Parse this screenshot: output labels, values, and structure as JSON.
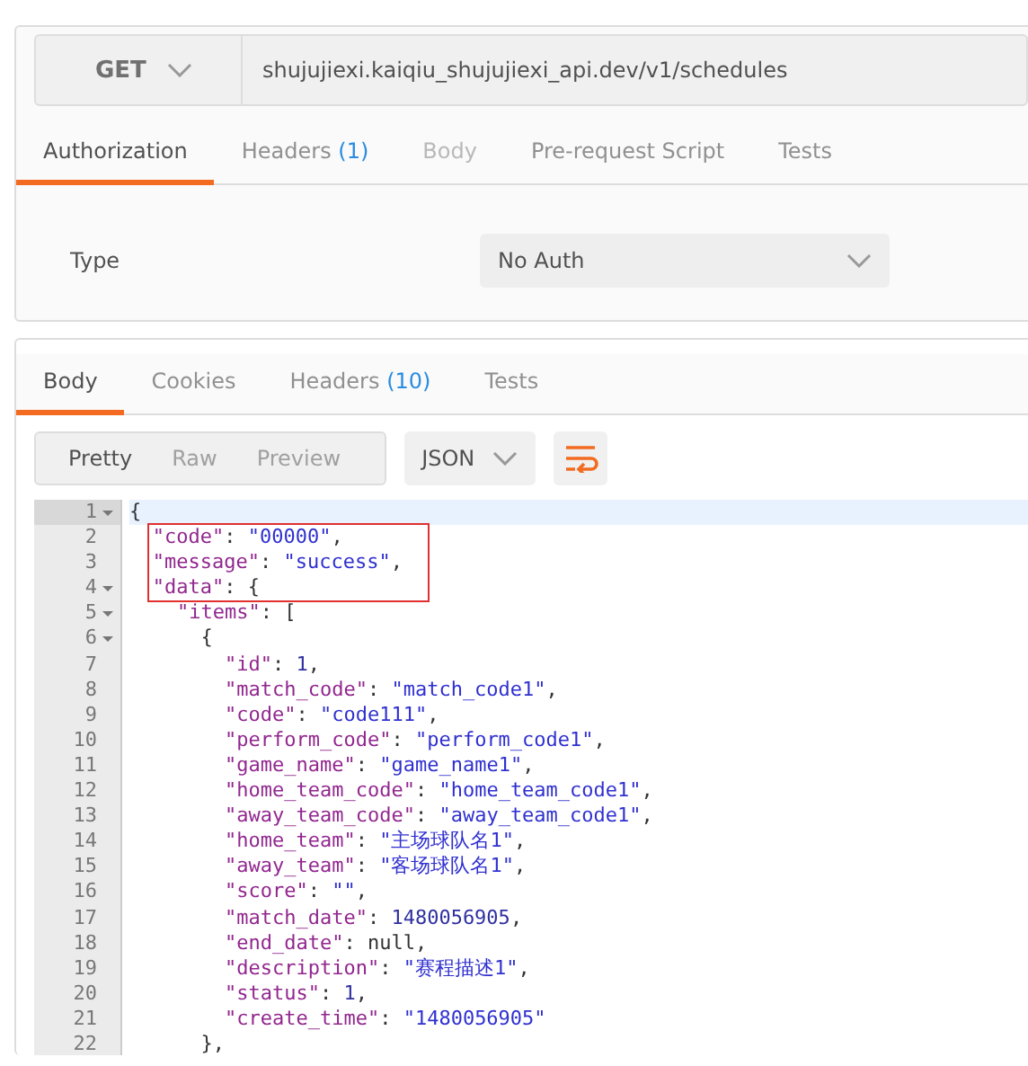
{
  "request": {
    "method": "GET",
    "url": "shujujiexi.kaiqiu_shujujiexi_api.dev/v1/schedules"
  },
  "request_tabs": [
    {
      "label": "Authorization",
      "selected": true,
      "disabled": false
    },
    {
      "label": "Headers",
      "count": "(1)",
      "selected": false,
      "disabled": false
    },
    {
      "label": "Body",
      "selected": false,
      "disabled": true
    },
    {
      "label": "Pre-request Script",
      "selected": false,
      "disabled": false
    },
    {
      "label": "Tests",
      "selected": false,
      "disabled": false
    }
  ],
  "auth": {
    "label": "Type",
    "value": "No Auth"
  },
  "response_tabs": [
    {
      "label": "Body",
      "selected": true
    },
    {
      "label": "Cookies",
      "selected": false
    },
    {
      "label": "Headers",
      "count": "(10)",
      "selected": false
    },
    {
      "label": "Tests",
      "selected": false
    }
  ],
  "view_modes": [
    {
      "label": "Pretty",
      "selected": true
    },
    {
      "label": "Raw",
      "selected": false
    },
    {
      "label": "Preview",
      "selected": false
    }
  ],
  "format": {
    "value": "JSON"
  },
  "wrap_lines": {
    "on": true
  },
  "code_lines": [
    {
      "number": "1",
      "fold": true,
      "active": true,
      "boxed": false,
      "tokens": [
        {
          "kind": "punct",
          "text": "{"
        }
      ]
    },
    {
      "number": "2",
      "fold": false,
      "active": false,
      "boxed": true,
      "tokens": [
        {
          "kind": "key",
          "text": "  \"code\""
        },
        {
          "kind": "punct",
          "text": ": "
        },
        {
          "kind": "string",
          "text": "\"00000\""
        },
        {
          "kind": "punct",
          "text": ","
        }
      ]
    },
    {
      "number": "3",
      "fold": false,
      "active": false,
      "boxed": true,
      "tokens": [
        {
          "kind": "key",
          "text": "  \"message\""
        },
        {
          "kind": "punct",
          "text": ": "
        },
        {
          "kind": "string",
          "text": "\"success\""
        },
        {
          "kind": "punct",
          "text": ","
        }
      ]
    },
    {
      "number": "4",
      "fold": true,
      "active": false,
      "boxed": true,
      "tokens": [
        {
          "kind": "key",
          "text": "  \"data\""
        },
        {
          "kind": "punct",
          "text": ": {"
        }
      ]
    },
    {
      "number": "5",
      "fold": true,
      "active": false,
      "boxed": false,
      "tokens": [
        {
          "kind": "key",
          "text": "    \"items\""
        },
        {
          "kind": "punct",
          "text": ": ["
        }
      ]
    },
    {
      "number": "6",
      "fold": true,
      "active": false,
      "boxed": false,
      "tokens": [
        {
          "kind": "punct",
          "text": "      {"
        }
      ]
    },
    {
      "number": "7",
      "fold": false,
      "active": false,
      "boxed": false,
      "tokens": [
        {
          "kind": "key",
          "text": "        \"id\""
        },
        {
          "kind": "punct",
          "text": ": "
        },
        {
          "kind": "number",
          "text": "1"
        },
        {
          "kind": "punct",
          "text": ","
        }
      ]
    },
    {
      "number": "8",
      "fold": false,
      "active": false,
      "boxed": false,
      "tokens": [
        {
          "kind": "key",
          "text": "        \"match_code\""
        },
        {
          "kind": "punct",
          "text": ": "
        },
        {
          "kind": "string",
          "text": "\"match_code1\""
        },
        {
          "kind": "punct",
          "text": ","
        }
      ]
    },
    {
      "number": "9",
      "fold": false,
      "active": false,
      "boxed": false,
      "tokens": [
        {
          "kind": "key",
          "text": "        \"code\""
        },
        {
          "kind": "punct",
          "text": ": "
        },
        {
          "kind": "string",
          "text": "\"code111\""
        },
        {
          "kind": "punct",
          "text": ","
        }
      ]
    },
    {
      "number": "10",
      "fold": false,
      "active": false,
      "boxed": false,
      "tokens": [
        {
          "kind": "key",
          "text": "        \"perform_code\""
        },
        {
          "kind": "punct",
          "text": ": "
        },
        {
          "kind": "string",
          "text": "\"perform_code1\""
        },
        {
          "kind": "punct",
          "text": ","
        }
      ]
    },
    {
      "number": "11",
      "fold": false,
      "active": false,
      "boxed": false,
      "tokens": [
        {
          "kind": "key",
          "text": "        \"game_name\""
        },
        {
          "kind": "punct",
          "text": ": "
        },
        {
          "kind": "string",
          "text": "\"game_name1\""
        },
        {
          "kind": "punct",
          "text": ","
        }
      ]
    },
    {
      "number": "12",
      "fold": false,
      "active": false,
      "boxed": false,
      "tokens": [
        {
          "kind": "key",
          "text": "        \"home_team_code\""
        },
        {
          "kind": "punct",
          "text": ": "
        },
        {
          "kind": "string",
          "text": "\"home_team_code1\""
        },
        {
          "kind": "punct",
          "text": ","
        }
      ]
    },
    {
      "number": "13",
      "fold": false,
      "active": false,
      "boxed": false,
      "tokens": [
        {
          "kind": "key",
          "text": "        \"away_team_code\""
        },
        {
          "kind": "punct",
          "text": ": "
        },
        {
          "kind": "string",
          "text": "\"away_team_code1\""
        },
        {
          "kind": "punct",
          "text": ","
        }
      ]
    },
    {
      "number": "14",
      "fold": false,
      "active": false,
      "boxed": false,
      "tokens": [
        {
          "kind": "key",
          "text": "        \"home_team\""
        },
        {
          "kind": "punct",
          "text": ": "
        },
        {
          "kind": "string",
          "text": "\"主场球队名1\""
        },
        {
          "kind": "punct",
          "text": ","
        }
      ]
    },
    {
      "number": "15",
      "fold": false,
      "active": false,
      "boxed": false,
      "tokens": [
        {
          "kind": "key",
          "text": "        \"away_team\""
        },
        {
          "kind": "punct",
          "text": ": "
        },
        {
          "kind": "string",
          "text": "\"客场球队名1\""
        },
        {
          "kind": "punct",
          "text": ","
        }
      ]
    },
    {
      "number": "16",
      "fold": false,
      "active": false,
      "boxed": false,
      "tokens": [
        {
          "kind": "key",
          "text": "        \"score\""
        },
        {
          "kind": "punct",
          "text": ": "
        },
        {
          "kind": "string",
          "text": "\"\""
        },
        {
          "kind": "punct",
          "text": ","
        }
      ]
    },
    {
      "number": "17",
      "fold": false,
      "active": false,
      "boxed": false,
      "tokens": [
        {
          "kind": "key",
          "text": "        \"match_date\""
        },
        {
          "kind": "punct",
          "text": ": "
        },
        {
          "kind": "number",
          "text": "1480056905"
        },
        {
          "kind": "punct",
          "text": ","
        }
      ]
    },
    {
      "number": "18",
      "fold": false,
      "active": false,
      "boxed": false,
      "tokens": [
        {
          "kind": "key",
          "text": "        \"end_date\""
        },
        {
          "kind": "punct",
          "text": ": null,"
        }
      ]
    },
    {
      "number": "19",
      "fold": false,
      "active": false,
      "boxed": false,
      "tokens": [
        {
          "kind": "key",
          "text": "        \"description\""
        },
        {
          "kind": "punct",
          "text": ": "
        },
        {
          "kind": "string",
          "text": "\"赛程描述1\""
        },
        {
          "kind": "punct",
          "text": ","
        }
      ]
    },
    {
      "number": "20",
      "fold": false,
      "active": false,
      "boxed": false,
      "tokens": [
        {
          "kind": "key",
          "text": "        \"status\""
        },
        {
          "kind": "punct",
          "text": ": "
        },
        {
          "kind": "number",
          "text": "1"
        },
        {
          "kind": "punct",
          "text": ","
        }
      ]
    },
    {
      "number": "21",
      "fold": false,
      "active": false,
      "boxed": false,
      "tokens": [
        {
          "kind": "key",
          "text": "        \"create_time\""
        },
        {
          "kind": "punct",
          "text": ": "
        },
        {
          "kind": "string",
          "text": "\"1480056905\""
        }
      ]
    },
    {
      "number": "22",
      "fold": false,
      "active": false,
      "boxed": false,
      "tokens": [
        {
          "kind": "punct",
          "text": "      },"
        }
      ]
    }
  ]
}
